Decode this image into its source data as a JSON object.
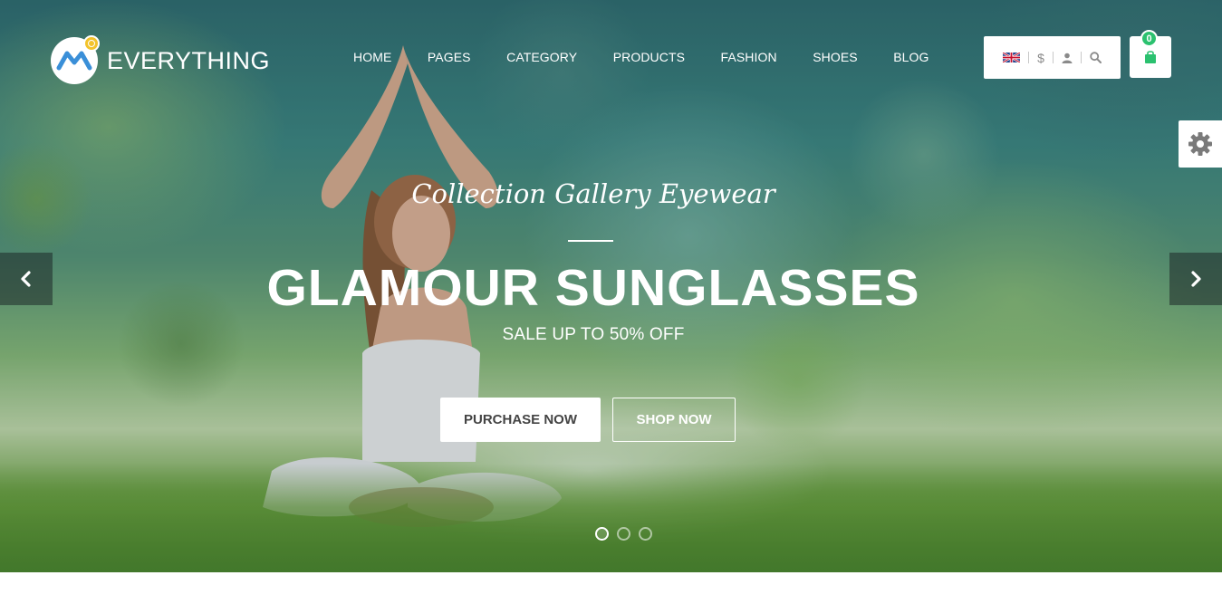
{
  "brand": {
    "name": "EVERYTHING",
    "logo_icon": "m-logo-icon"
  },
  "nav": {
    "items": [
      {
        "label": "HOME"
      },
      {
        "label": "PAGES"
      },
      {
        "label": "CATEGORY"
      },
      {
        "label": "PRODUCTS"
      },
      {
        "label": "FASHION"
      },
      {
        "label": "SHOES"
      },
      {
        "label": "BLOG"
      }
    ]
  },
  "toolbar": {
    "language_icon": "uk-flag-icon",
    "currency_symbol": "$",
    "account_icon": "user-icon",
    "search_icon": "search-icon"
  },
  "cart": {
    "count": "0",
    "icon": "shopping-bag-icon",
    "badge_color": "#2bc16f"
  },
  "settings": {
    "icon": "gear-icon"
  },
  "slider": {
    "prev_icon": "chevron-left-icon",
    "next_icon": "chevron-right-icon",
    "slide": {
      "script_title": "Collection Gallery Eyewear",
      "headline": "GLAMOUR SUNGLASSES",
      "subline": "SALE UP TO 50% OFF",
      "primary_button": "PURCHASE NOW",
      "secondary_button": "SHOP NOW"
    },
    "pagination": {
      "total": 3,
      "active": 1
    }
  }
}
